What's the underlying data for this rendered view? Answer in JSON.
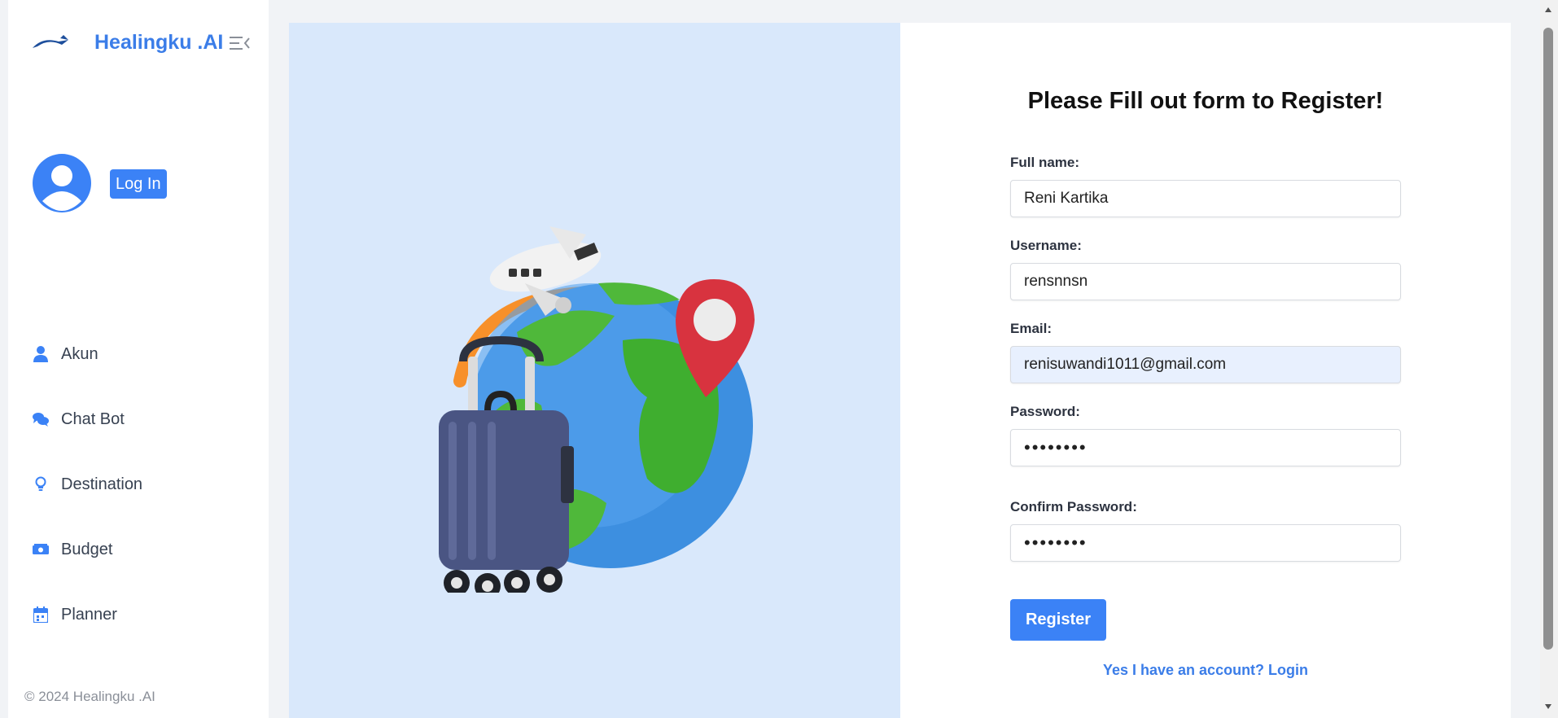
{
  "sidebar": {
    "brand_name": "Healingku .AI",
    "login_label": "Log In",
    "items": [
      {
        "label": "Akun",
        "icon": "user-icon"
      },
      {
        "label": "Chat Bot",
        "icon": "comments-icon"
      },
      {
        "label": "Destination",
        "icon": "lightbulb-icon"
      },
      {
        "label": "Budget",
        "icon": "money-icon"
      },
      {
        "label": "Planner",
        "icon": "calendar-icon"
      }
    ],
    "footer": "© 2024 Healingku .AI"
  },
  "form": {
    "title": "Please Fill out form to Register!",
    "fields": [
      {
        "label": "Full name:",
        "value": "Reni Kartika"
      },
      {
        "label": "Username:",
        "value": "rensnnsn"
      },
      {
        "label": "Email:",
        "value": "renisuwandi1011@gmail.com"
      },
      {
        "label": "Password:",
        "value": "••••••••"
      },
      {
        "label": "Confirm Password:",
        "value": "••••••••"
      }
    ],
    "register_label": "Register",
    "login_link": "Yes I have an account? Login"
  },
  "colors": {
    "accent": "#3b82f6",
    "brand": "#3b7de8",
    "panel_bg": "#d9e8fb",
    "autofill_bg": "#e8f0fe"
  }
}
